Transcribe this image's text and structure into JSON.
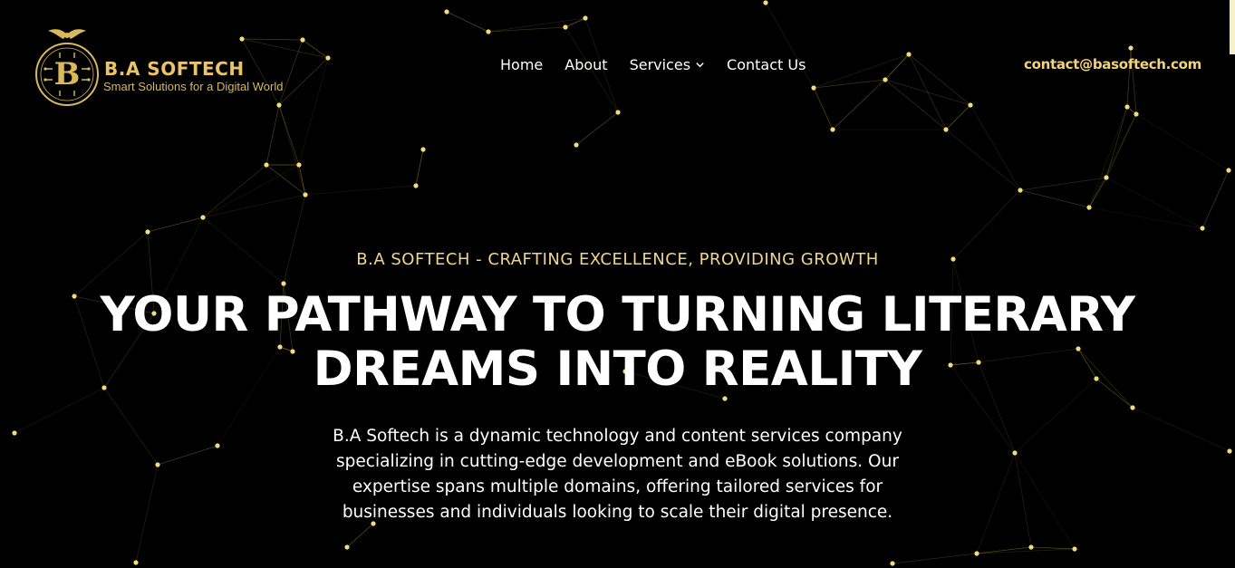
{
  "brand": {
    "name": "B.A SOFTECH",
    "tagline": "Smart Solutions for a Digital World",
    "monogram": "B",
    "color": "#e9c46a"
  },
  "nav": {
    "items": [
      {
        "label": "Home"
      },
      {
        "label": "About"
      },
      {
        "label": "Services",
        "has_dropdown": true
      },
      {
        "label": "Contact Us"
      }
    ]
  },
  "contact": {
    "email": "contact@basoftech.com"
  },
  "hero": {
    "kicker": "B.A SOFTECH - CRAFTING EXCELLENCE, PROVIDING GROWTH",
    "title": "YOUR PATHWAY TO TURNING LITERARY DREAMS INTO REALITY",
    "description": "B.A Softech is a dynamic technology and content services company specializing in cutting-edge development and eBook solutions. Our expertise spans multiple domains, offering tailored services for businesses and individuals looking to scale their digital presence."
  },
  "background": {
    "style": "particle-network",
    "node_color": "#f3dc7c",
    "line_color": "#b89a3a"
  }
}
